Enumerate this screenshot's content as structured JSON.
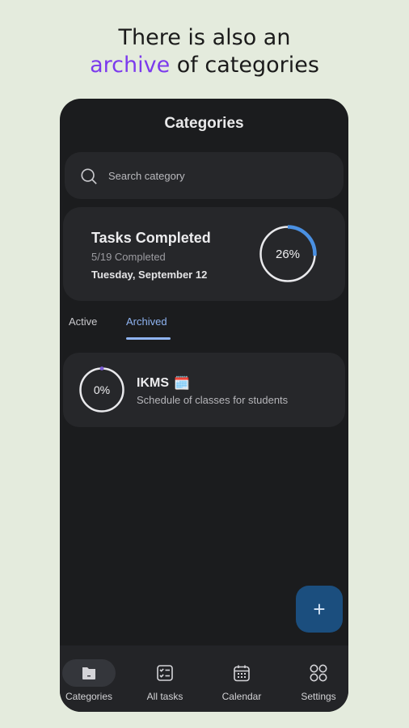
{
  "headline": {
    "line1": "There is also an",
    "accent": "archive",
    "rest": " of categories"
  },
  "app": {
    "title": "Categories"
  },
  "search": {
    "placeholder": "Search category",
    "icon": "search-icon"
  },
  "summary": {
    "title": "Tasks Completed",
    "count": "5/19 Completed",
    "date": "Tuesday, September 12",
    "percent_label": "26%",
    "progress": 0.26,
    "ring_color": "#4a90e2"
  },
  "tabs": [
    {
      "label": "Active"
    },
    {
      "label": "Archived"
    }
  ],
  "selected_tab": "Archived",
  "categories": [
    {
      "name": "IKMS",
      "emoji": "🗓️",
      "description": "Schedule of classes for students",
      "percent_label": "0%",
      "progress": 0,
      "ring_color": "#7c5cd6"
    }
  ],
  "fab": {
    "label": "+"
  },
  "nav": [
    {
      "label": "Categories",
      "icon": "categories-icon"
    },
    {
      "label": "All tasks",
      "icon": "checklist-icon"
    },
    {
      "label": "Calendar",
      "icon": "calendar-icon"
    },
    {
      "label": "Settings",
      "icon": "settings-grid-icon"
    }
  ],
  "nav_selected": "Categories",
  "colors": {
    "accent": "#7c3aed",
    "tab_active": "#8fb4f2",
    "fab": "#1b4e7e"
  }
}
